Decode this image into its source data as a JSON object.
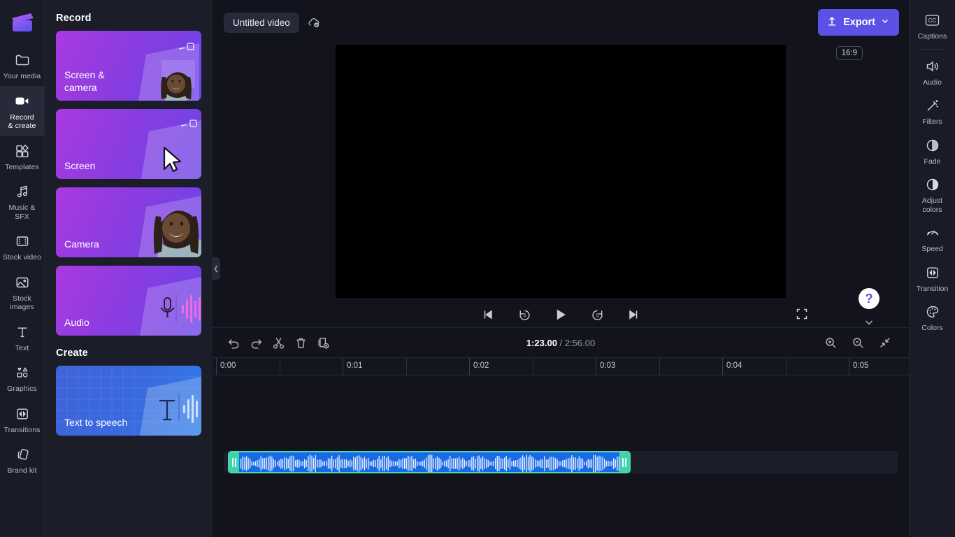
{
  "left_rail": {
    "logo": "clipchamp-logo",
    "items": [
      {
        "label": "Your media",
        "icon": "folder-icon",
        "active": false
      },
      {
        "label": "Record\n& create",
        "icon": "video-camera-icon",
        "active": true
      },
      {
        "label": "Templates",
        "icon": "templates-icon",
        "active": false
      },
      {
        "label": "Music & SFX",
        "icon": "music-note-icon",
        "active": false
      },
      {
        "label": "Stock video",
        "icon": "film-strip-icon",
        "active": false
      },
      {
        "label": "Stock\nimages",
        "icon": "image-icon",
        "active": false
      },
      {
        "label": "Text",
        "icon": "text-icon",
        "active": false
      },
      {
        "label": "Graphics",
        "icon": "shapes-icon",
        "active": false
      },
      {
        "label": "Transitions",
        "icon": "transition-icon",
        "active": false
      },
      {
        "label": "Brand kit",
        "icon": "brand-kit-icon",
        "active": false
      }
    ]
  },
  "panel": {
    "record_heading": "Record",
    "create_heading": "Create",
    "record_cards": [
      {
        "label": "Screen &\ncamera",
        "art": "screen-camera-art",
        "theme": "purple"
      },
      {
        "label": "Screen",
        "art": "screen-art",
        "theme": "purple"
      },
      {
        "label": "Camera",
        "art": "camera-art",
        "theme": "purple"
      },
      {
        "label": "Audio",
        "art": "audio-art",
        "theme": "purple"
      }
    ],
    "create_cards": [
      {
        "label": "Text to speech",
        "art": "text-to-speech-art",
        "theme": "blue"
      }
    ],
    "collapse_icon": "chevron-left-icon"
  },
  "topbar": {
    "project_title": "Untitled video",
    "save_status_icon": "cloud-saved-icon",
    "export_label": "Export",
    "export_icon": "upload-icon",
    "export_chevron": "chevron-down-icon",
    "export_color": "#5b51e6"
  },
  "preview": {
    "aspect_ratio": "16:9",
    "background": "#000000",
    "controls": [
      {
        "name": "skip-to-start-button",
        "icon": "skip-previous-icon"
      },
      {
        "name": "rewind-5-button",
        "icon": "rewind-5-icon",
        "seconds": "5"
      },
      {
        "name": "play-button",
        "icon": "play-icon"
      },
      {
        "name": "forward-5-button",
        "icon": "forward-5-icon",
        "seconds": "5"
      },
      {
        "name": "skip-to-end-button",
        "icon": "skip-next-icon"
      }
    ],
    "fullscreen_icon": "fullscreen-icon",
    "help_label": "?",
    "help_color": "#6b4ce0",
    "collapse_preview_icon": "chevron-down-icon"
  },
  "timeline": {
    "tools": [
      {
        "name": "undo-button",
        "icon": "undo-icon"
      },
      {
        "name": "redo-button",
        "icon": "redo-icon"
      },
      {
        "name": "split-button",
        "icon": "scissors-icon"
      },
      {
        "name": "delete-button",
        "icon": "trash-icon"
      },
      {
        "name": "duplicate-button",
        "icon": "duplicate-icon"
      }
    ],
    "current_time": "1:23.00",
    "time_separator": "/",
    "total_time": "2:56.00",
    "zoom_in_icon": "zoom-in-icon",
    "zoom_out_icon": "zoom-out-icon",
    "fit_icon": "fit-to-screen-icon",
    "ruler_labels": [
      "0:00",
      "0:01",
      "0:02",
      "0:03",
      "0:04",
      "0:05"
    ],
    "clip": {
      "name": "audio-clip",
      "type": "audio",
      "selected": true,
      "fill_color": "#1769e8",
      "selection_color": "#4bdba4"
    }
  },
  "right_rail": {
    "items": [
      {
        "label": "Captions",
        "icon": "cc-icon",
        "separator_after": true
      },
      {
        "label": "Audio",
        "icon": "speaker-icon",
        "separator_after": false
      },
      {
        "label": "Filters",
        "icon": "magic-wand-icon",
        "separator_after": false
      },
      {
        "label": "Fade",
        "icon": "fade-icon",
        "separator_after": false
      },
      {
        "label": "Adjust\ncolors",
        "icon": "contrast-icon",
        "separator_after": false
      },
      {
        "label": "Speed",
        "icon": "speedometer-icon",
        "separator_after": false
      },
      {
        "label": "Transition",
        "icon": "transition-icon",
        "separator_after": false
      },
      {
        "label": "Colors",
        "icon": "palette-icon",
        "separator_after": false
      }
    ]
  }
}
